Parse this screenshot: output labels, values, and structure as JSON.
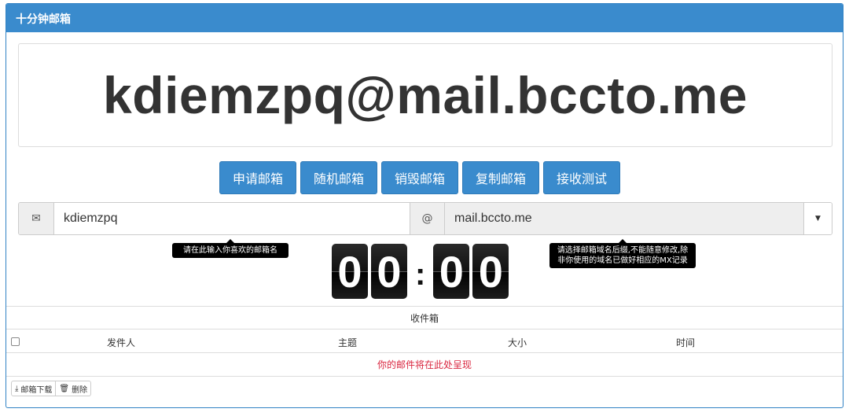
{
  "header": {
    "title": "十分钟邮箱"
  },
  "email": {
    "address": "kdiemzpq@mail.bccto.me"
  },
  "actions": {
    "apply": "申请邮箱",
    "random": "随机邮箱",
    "destroy": "销毁邮箱",
    "copy": "复制邮箱",
    "receive_test": "接收测试"
  },
  "form": {
    "mail_icon": "✉",
    "at_symbol": "@",
    "username_value": "kdiemzpq",
    "domain_value": "mail.bccto.me",
    "caret": "▼"
  },
  "tooltips": {
    "username": "请在此输入你喜欢的邮箱名",
    "domain": "请选择邮箱域名后缀,不能随意修改,除非你使用的域名已做好相应的MX记录"
  },
  "timer": {
    "d1": "0",
    "d2": "0",
    "colon": ":",
    "d3": "0",
    "d4": "0"
  },
  "inbox": {
    "title": "收件箱",
    "columns": {
      "sender": "发件人",
      "subject": "主题",
      "size": "大小",
      "time": "时间"
    },
    "empty_message": "你的邮件将在此处呈现"
  },
  "footer": {
    "download_icon": "⤓",
    "download_label": "邮箱下载",
    "delete_icon": "🗑",
    "delete_label": "删除"
  },
  "colors": {
    "primary": "#3a8bcd",
    "empty_text": "#d9263f",
    "timer_bg": "#111111"
  }
}
